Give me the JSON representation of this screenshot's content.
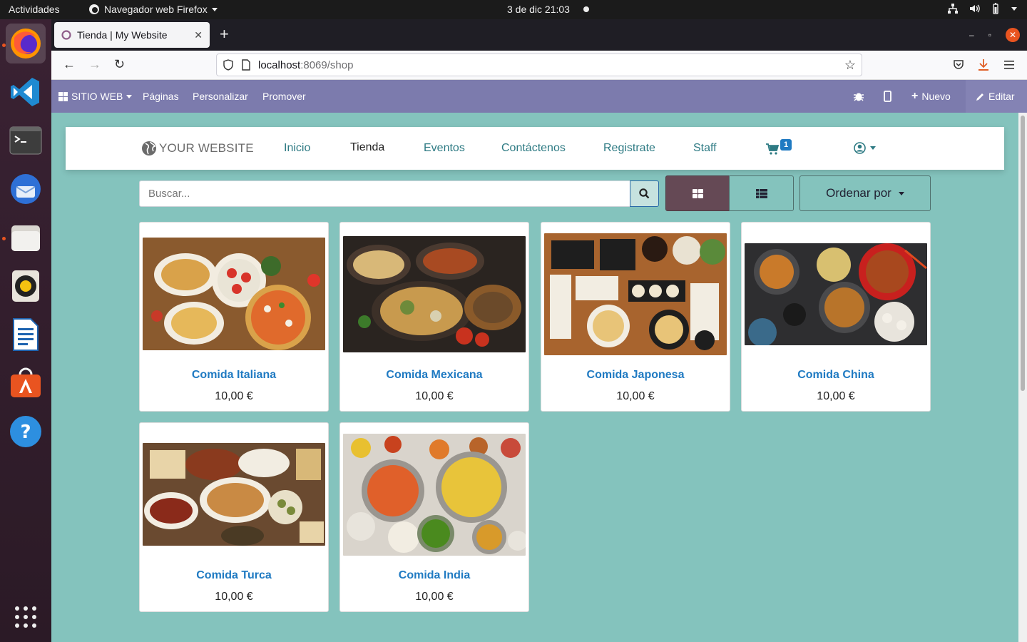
{
  "topbar": {
    "activities": "Actividades",
    "app_name": "Navegador web Firefox",
    "clock": "3 de dic  21:03"
  },
  "dock": {
    "items": [
      {
        "name": "firefox-icon"
      },
      {
        "name": "vscode-icon"
      },
      {
        "name": "terminal-icon"
      },
      {
        "name": "thunderbird-icon"
      },
      {
        "name": "files-icon"
      },
      {
        "name": "rhythmbox-icon"
      },
      {
        "name": "writer-icon"
      },
      {
        "name": "software-icon"
      },
      {
        "name": "help-icon"
      },
      {
        "name": "apps-grid-icon"
      }
    ]
  },
  "browser": {
    "tab_title": "Tienda | My Website",
    "url_host": "localhost",
    "url_rest": ":8069/shop"
  },
  "odoo_bar": {
    "website_menu": "SITIO WEB",
    "pages": "Páginas",
    "customize": "Personalizar",
    "promote": "Promover",
    "new": "Nuevo",
    "edit": "Editar"
  },
  "site": {
    "logo_text": "YOUR WEBSITE",
    "nav": [
      "Inicio",
      "Tienda",
      "Eventos",
      "Contáctenos",
      "Registrate",
      "Staff"
    ],
    "cart_count": "1"
  },
  "shop": {
    "search_placeholder": "Buscar...",
    "sort_label": "Ordenar por",
    "products": [
      {
        "name": "Comida Italiana",
        "price": "10,00 €"
      },
      {
        "name": "Comida Mexicana",
        "price": "10,00 €"
      },
      {
        "name": "Comida Japonesa",
        "price": "10,00 €"
      },
      {
        "name": "Comida China",
        "price": "10,00 €"
      },
      {
        "name": "Comida Turca",
        "price": "10,00 €"
      },
      {
        "name": "Comida India",
        "price": "10,00 €"
      }
    ]
  },
  "colors": {
    "admin_bar": "#7c7bad",
    "page_bg": "#84c3bd",
    "link": "#1f7ac2",
    "nav_link": "#2d7a83",
    "active_view": "#654955",
    "ubuntu_accent": "#e95420"
  }
}
